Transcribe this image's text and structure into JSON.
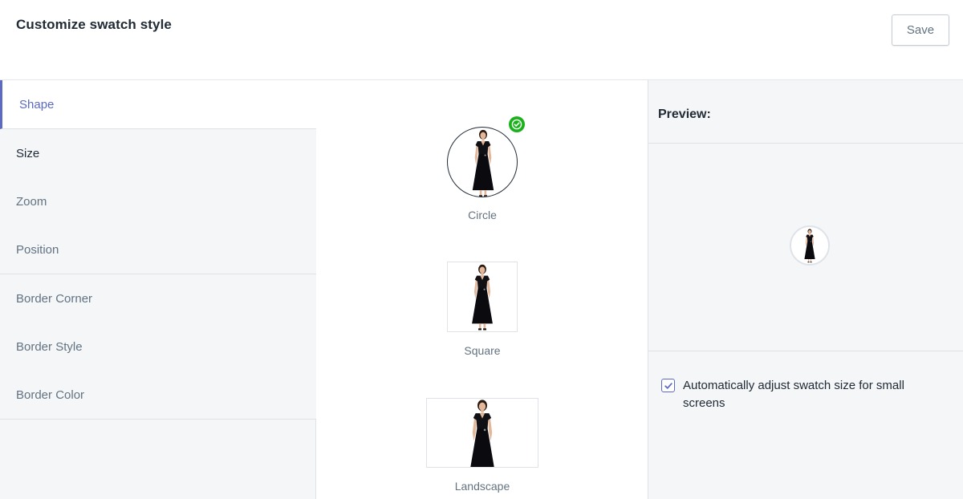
{
  "header": {
    "title": "Customize swatch style",
    "save_label": "Save"
  },
  "sidebar": {
    "items": [
      {
        "label": "Shape",
        "active": true
      },
      {
        "label": "Size",
        "active": false
      },
      {
        "label": "Zoom",
        "active": false
      },
      {
        "label": "Position",
        "active": false
      },
      {
        "label": "Border Corner",
        "active": false
      },
      {
        "label": "Border Style",
        "active": false
      },
      {
        "label": "Border Color",
        "active": false
      }
    ]
  },
  "shapes": [
    {
      "label": "Circle",
      "selected": true
    },
    {
      "label": "Square",
      "selected": false
    },
    {
      "label": "Landscape",
      "selected": false
    }
  ],
  "preview": {
    "title": "Preview:",
    "auto_adjust_label": "Automatically adjust swatch size for small screens",
    "auto_adjust_checked": true
  },
  "colors": {
    "accent": "#5c6ac4",
    "selected_check": "#1ab21a",
    "panel_bg": "#f4f6f8"
  },
  "icons": {
    "selected": "check-circle-icon",
    "checkbox": "checkmark-icon"
  }
}
